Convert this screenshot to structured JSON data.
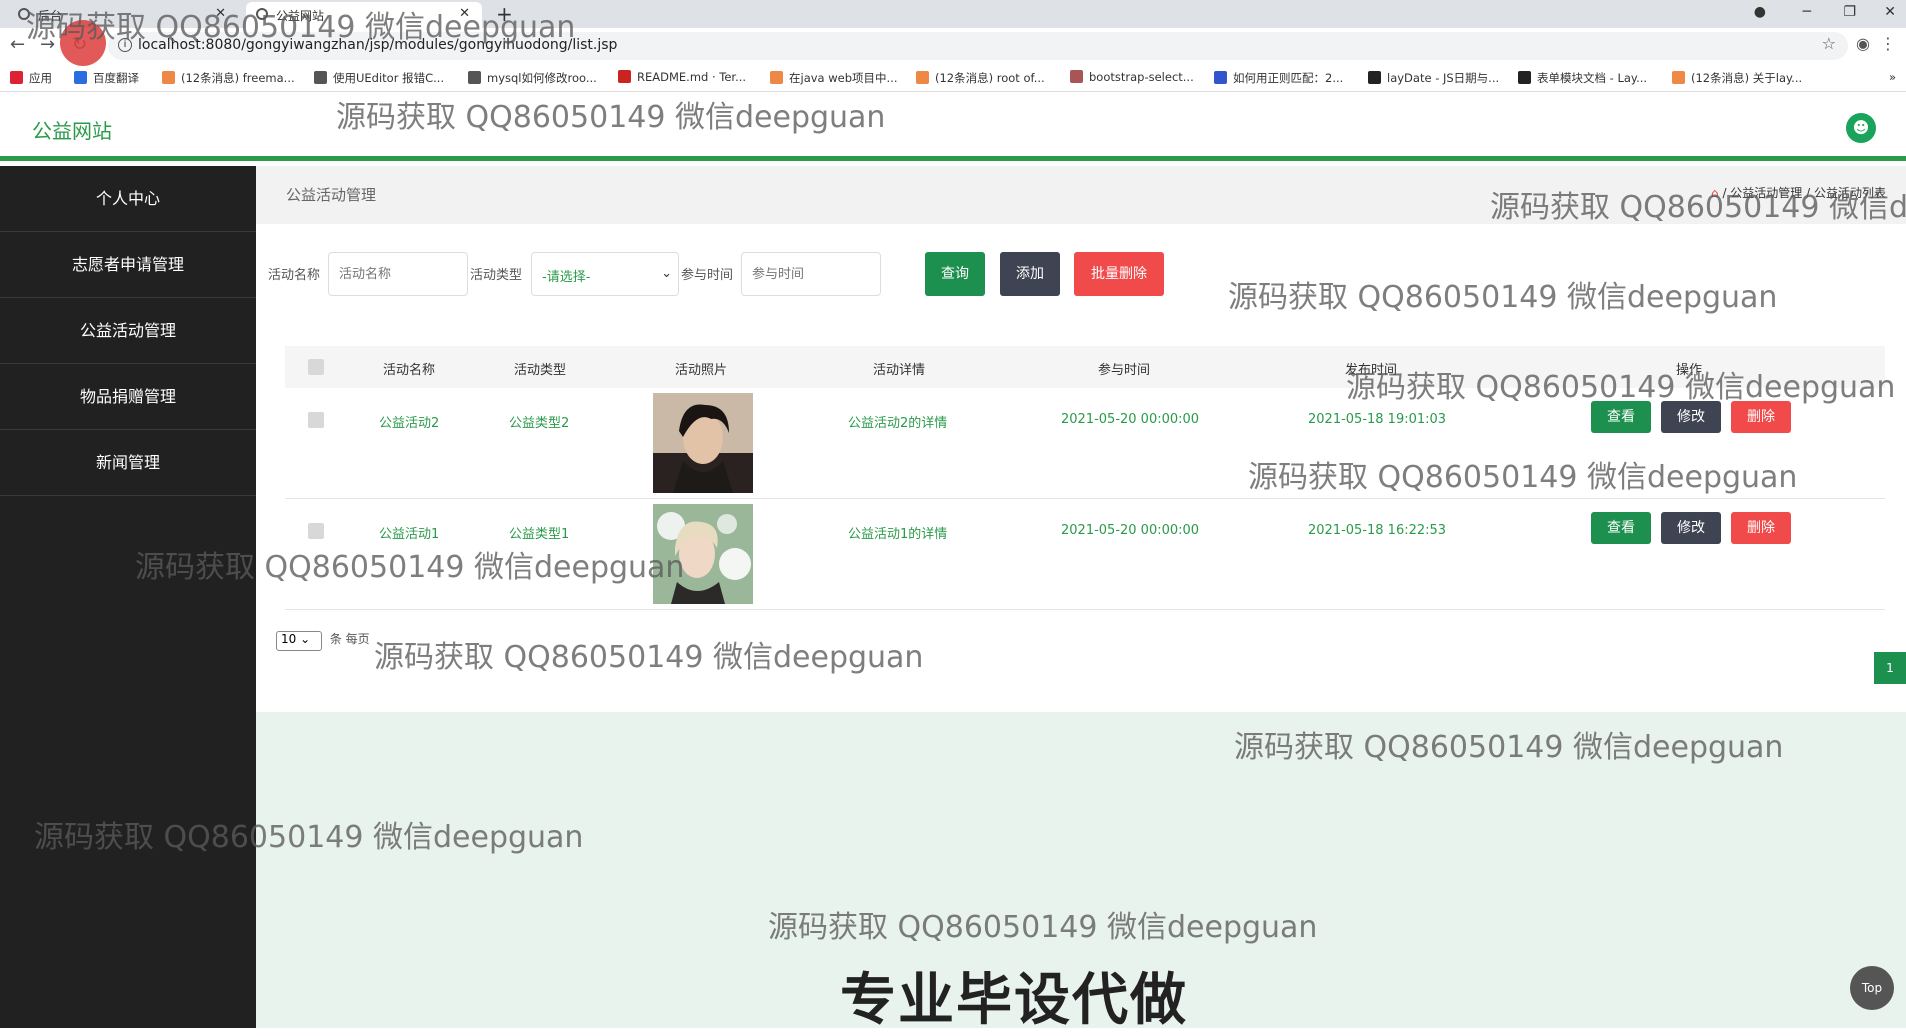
{
  "browser": {
    "tabs": [
      {
        "label": "后台"
      },
      {
        "label": "公益网站"
      }
    ],
    "new_tab": "+",
    "url": "localhost:8080/gongyiwangzhan/jsp/modules/gongyihuodong/list.jsp",
    "bookmarks": [
      {
        "label": "应用",
        "color": "#d23"
      },
      {
        "label": "百度翻译",
        "color": "#2b6de0"
      },
      {
        "label": "(12条消息) freema...",
        "color": "#e84"
      },
      {
        "label": "使用UEditor 报错C...",
        "color": "#555"
      },
      {
        "label": "mysql如何修改roo...",
        "color": "#555"
      },
      {
        "label": "README.md · Ter...",
        "color": "#c22"
      },
      {
        "label": "在java web项目中...",
        "color": "#e84"
      },
      {
        "label": "(12条消息) root of...",
        "color": "#e84"
      },
      {
        "label": "bootstrap-select...",
        "color": "#a55"
      },
      {
        "label": "如何用正则匹配：2...",
        "color": "#3355cc"
      },
      {
        "label": "layDate - JS日期与...",
        "color": "#222"
      },
      {
        "label": "表单模块文档 - Lay...",
        "color": "#222"
      },
      {
        "label": "(12条消息) 关于lay...",
        "color": "#e84"
      }
    ]
  },
  "header": {
    "site_name": "公益网站",
    "user_icon": "user-icon"
  },
  "sidebar": {
    "items": [
      {
        "label": "个人中心"
      },
      {
        "label": "志愿者申请管理"
      },
      {
        "label": "公益活动管理"
      },
      {
        "label": "物品捐赠管理"
      },
      {
        "label": "新闻管理"
      }
    ]
  },
  "page": {
    "title": "公益活动管理",
    "breadcrumb": [
      "公益活动管理",
      "公益活动列表"
    ]
  },
  "search": {
    "name_label": "活动名称",
    "name_placeholder": "活动名称",
    "type_label": "活动类型",
    "type_selected": "-请选择-",
    "time_label": "参与时间",
    "time_placeholder": "参与时间",
    "query_label": "查询",
    "add_label": "添加",
    "batch_delete_label": "批量删除"
  },
  "table": {
    "columns": [
      "活动名称",
      "活动类型",
      "活动照片",
      "活动详情",
      "参与时间",
      "发布时间",
      "操作"
    ],
    "rows": [
      {
        "name": "公益活动2",
        "type": "公益类型2",
        "detail": "公益活动2的详情",
        "join_time": "2021-05-20 00:00:00",
        "publish_time": "2021-05-18 19:01:03"
      },
      {
        "name": "公益活动1",
        "type": "公益类型1",
        "detail": "公益活动1的详情",
        "join_time": "2021-05-20 00:00:00",
        "publish_time": "2021-05-18 16:22:53"
      }
    ],
    "actions": {
      "view": "查看",
      "edit": "修改",
      "delete": "删除"
    }
  },
  "pagination": {
    "page_size": "10",
    "per_page_label": "条 每页",
    "current_page": "1"
  },
  "top_button": "Top",
  "watermark": "源码获取 QQ86050149 微信deepguan",
  "banner_text": "专业毕设代做",
  "colors": {
    "brand_green": "#2a9a4a",
    "sidebar_bg": "#212121",
    "delete_red": "#f04a4a",
    "edit_gray": "#3f4452"
  }
}
